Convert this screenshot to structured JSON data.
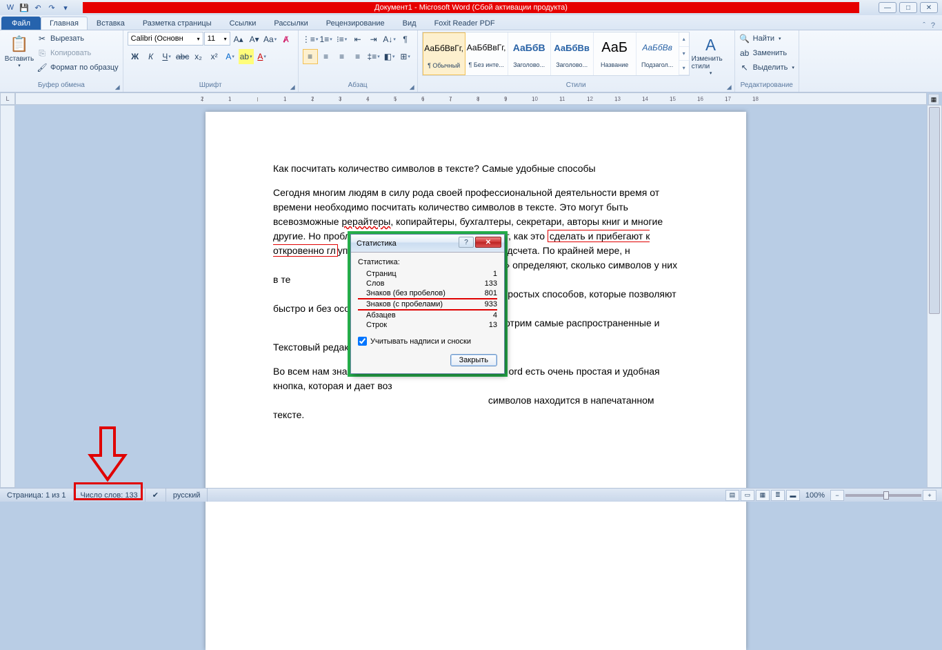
{
  "title": "Документ1 - Microsoft Word (Сбой активации продукта)",
  "qat": {
    "word": "W",
    "save": "💾",
    "undo": "↶",
    "redo": "↷",
    "more": "▾"
  },
  "tabs": {
    "file": "Файл",
    "items": [
      "Главная",
      "Вставка",
      "Разметка страницы",
      "Ссылки",
      "Рассылки",
      "Рецензирование",
      "Вид",
      "Foxit Reader PDF"
    ]
  },
  "ribbon": {
    "clipboard": {
      "title": "Буфер обмена",
      "paste": "Вставить",
      "cut": "Вырезать",
      "copy": "Копировать",
      "format_painter": "Формат по образцу"
    },
    "font": {
      "title": "Шрифт",
      "name": "Calibri (Основн",
      "size": "11"
    },
    "paragraph": {
      "title": "Абзац"
    },
    "styles": {
      "title": "Стили",
      "items": [
        {
          "preview": "АаБбВвГг,",
          "label": "¶ Обычный"
        },
        {
          "preview": "АаБбВвГг,",
          "label": "¶ Без инте..."
        },
        {
          "preview": "АаБбВ",
          "label": "Заголово..."
        },
        {
          "preview": "АаБбВв",
          "label": "Заголово..."
        },
        {
          "preview": "АаБ",
          "label": "Название"
        },
        {
          "preview": "АаБбВв",
          "label": "Подзагол..."
        }
      ],
      "change": "Изменить стили"
    },
    "editing": {
      "title": "Редактирование",
      "find": "Найти",
      "replace": "Заменить",
      "select": "Выделить"
    }
  },
  "ruler_marks": [
    "2",
    "1",
    "",
    "1",
    "2",
    "3",
    "4",
    "5",
    "6",
    "7",
    "8",
    "9",
    "10",
    "11",
    "12",
    "13",
    "14",
    "15",
    "16",
    "17",
    "18"
  ],
  "document": {
    "heading": "Как посчитать количество символов в тексте? Самые удобные способы",
    "p1a": "Сегодня многим людям в силу рода своей профессиональной деятельности время от времени необходимо посчитать количество символов в тексте. Это могут быть всевозможные ",
    "p1_link": "рерайтеры",
    "p1b": ", копирайтеры, бухгалтеры, секретари, авторы книг и многие другие. Но проблема в том, что далеко не все знают, как это ",
    "p1_mark": "сделать и прибегают к откровенно гл",
    "p1c": "упым способам, вплоть до ручного подсчета. По крайней мере, н",
    "p1d": " которые «на глаз» определяют, сколько символов у них в те",
    "p1e": "ень простых способов, которые позволяют быстро и без особ",
    "p1f": "в в тексте. Рассмотрим самые распространенные и",
    "p2": "Текстовый редакто",
    "p3a": "Во всем нам знако",
    "p3b": "ord есть очень простая и удобная кнопка, которая и дает воз",
    "p3c": " символов находится в напечатанном тексте."
  },
  "dialog": {
    "title": "Статистика",
    "header": "Статистика:",
    "rows": [
      {
        "label": "Страниц",
        "value": "1"
      },
      {
        "label": "Слов",
        "value": "133"
      },
      {
        "label": "Знаков (без пробелов)",
        "value": "801"
      },
      {
        "label": "Знаков (с пробелами)",
        "value": "933"
      },
      {
        "label": "Абзацев",
        "value": "4"
      },
      {
        "label": "Строк",
        "value": "13"
      }
    ],
    "checkbox": "Учитывать надписи и сноски",
    "close": "Закрыть"
  },
  "statusbar": {
    "page": "Страница: 1 из 1",
    "words": "Число слов: 133",
    "lang": "русский",
    "zoom": "100%"
  },
  "colors": {
    "accent": "#2663ad",
    "annotation": "#e00000",
    "dialog_border": "#26b44d"
  }
}
